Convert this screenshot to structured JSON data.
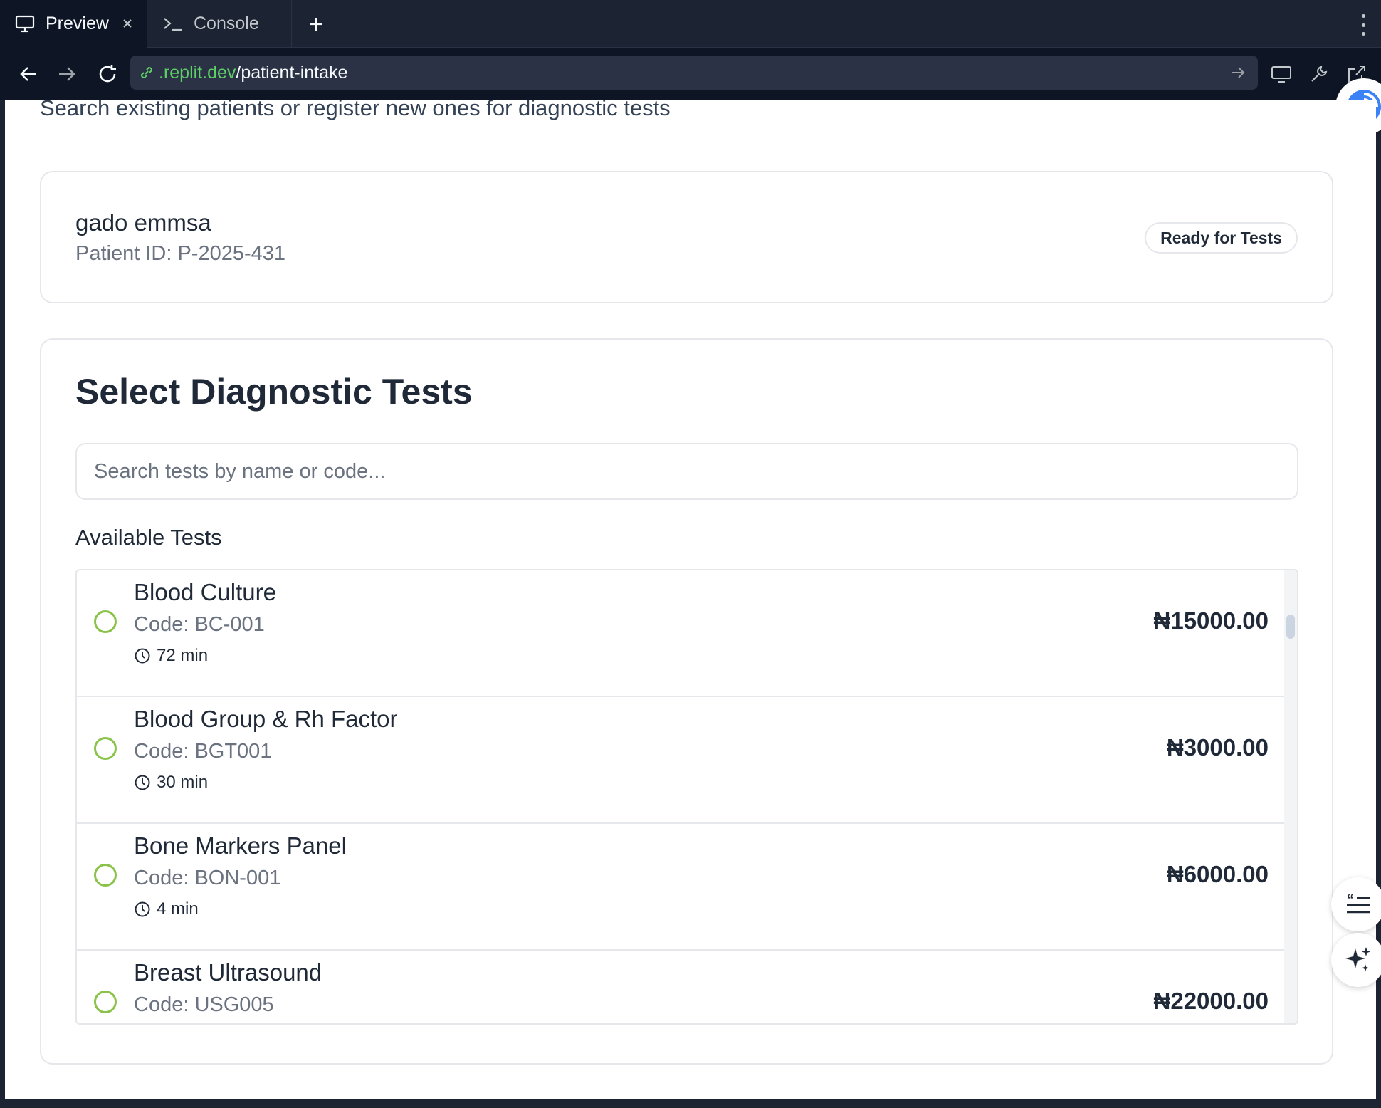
{
  "browser": {
    "tabs": [
      {
        "label": "Preview",
        "icon": "monitor-icon",
        "active": true
      },
      {
        "label": "Console",
        "icon": "terminal-icon",
        "active": false
      }
    ],
    "url": {
      "domain": ".replit.dev",
      "path": "/patient-intake"
    }
  },
  "page": {
    "subtitle": "Search existing patients or register new ones for diagnostic tests"
  },
  "patient": {
    "name": "gado emmsa",
    "id_text": "Patient ID: P-2025-431",
    "status": "Ready for Tests"
  },
  "tests": {
    "title": "Select Diagnostic Tests",
    "search_placeholder": "Search tests by name or code...",
    "available_label": "Available Tests",
    "items": [
      {
        "name": "Blood Culture",
        "code": "Code: BC-001",
        "duration": "72 min",
        "price": "₦15000.00"
      },
      {
        "name": "Blood Group & Rh Factor",
        "code": "Code: BGT001",
        "duration": "30 min",
        "price": "₦3000.00"
      },
      {
        "name": "Bone Markers Panel",
        "code": "Code: BON-001",
        "duration": "4 min",
        "price": "₦6000.00"
      },
      {
        "name": "Breast Ultrasound",
        "code": "Code: USG005",
        "duration": "",
        "price": "₦22000.00"
      }
    ]
  },
  "colors": {
    "accent_green": "#8bc34a",
    "url_domain": "#5ed166",
    "chrome_bg": "#1c2333"
  }
}
